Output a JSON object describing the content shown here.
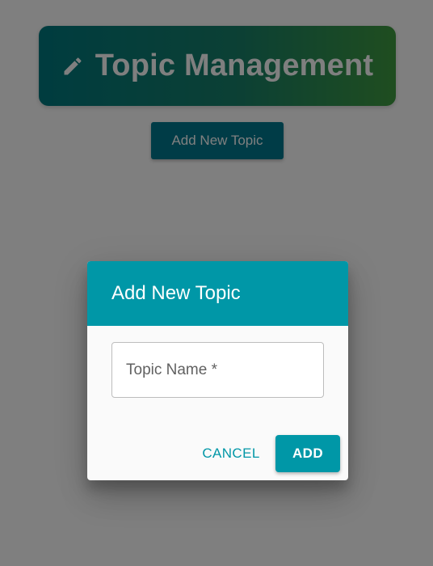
{
  "header": {
    "title": "Topic Management",
    "icon": "pencil-icon"
  },
  "toolbar": {
    "add_new_topic_label": "Add New Topic"
  },
  "dialog": {
    "title": "Add New Topic",
    "topic_name_field": {
      "label": "Topic Name *",
      "value": ""
    },
    "cancel_label": "CANCEL",
    "add_label": "ADD"
  },
  "colors": {
    "accent": "#0097a7",
    "header_gradient_start": "#00797f",
    "header_gradient_end": "#3f9b40",
    "backdrop": "rgba(0,0,0,0.5)"
  }
}
